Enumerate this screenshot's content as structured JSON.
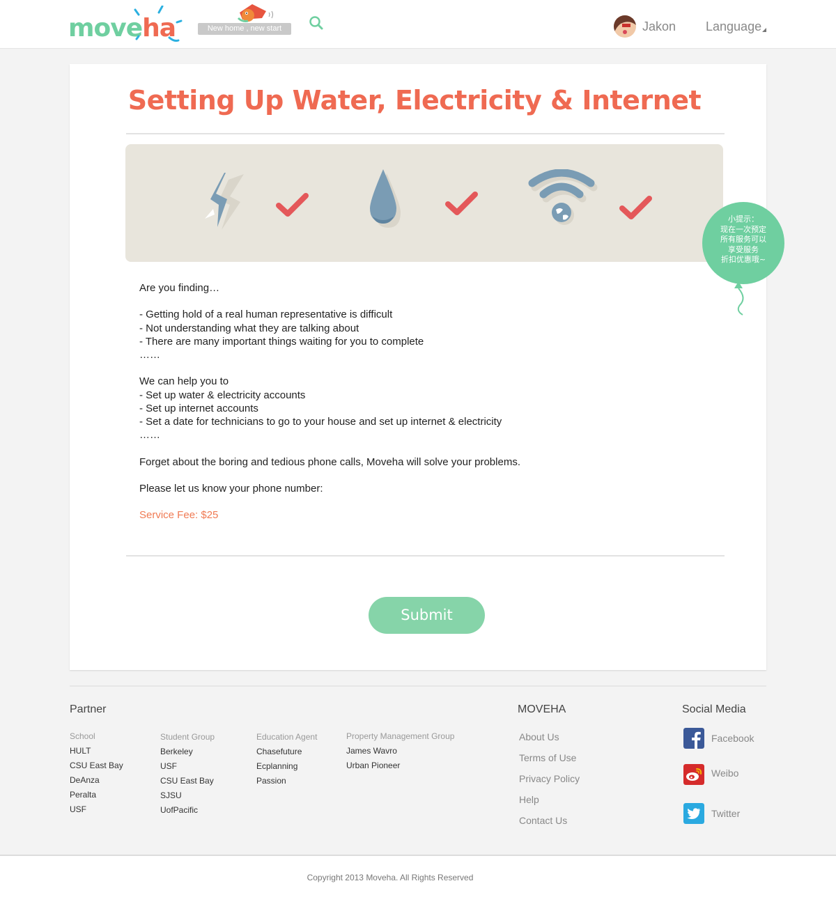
{
  "header": {
    "logo_part1": "move",
    "logo_part2": "ha",
    "tagline": "New home ,  new start",
    "username": "Jakon",
    "language": "Language"
  },
  "main": {
    "title": "Setting Up Water, Electricity & Internet",
    "intro": "Are you finding…",
    "problems": [
      "- Getting hold of a real human representative is difficult",
      "- Not understanding what they are talking about",
      "- There are many important things waiting for you to complete",
      "……"
    ],
    "help_heading": "We can help you to",
    "help_items": [
      "- Set up water & electricity accounts",
      "- Set up internet accounts",
      "- Set a date for technicians to go to your house and set up internet & electricity",
      "……"
    ],
    "closing": "Forget about the boring and tedious phone calls, Moveha will solve your problems.",
    "phone_prompt": "Please let us know your phone number:",
    "service_fee": "Service Fee: $25",
    "submit_label": "Submit"
  },
  "tip_balloon": {
    "lines": [
      "小提示：",
      "现在一次预定",
      "所有服务可以",
      "享受服务",
      "折扣优惠哦~"
    ]
  },
  "footer": {
    "partner_heading": "Partner",
    "columns": [
      {
        "category": "School",
        "items": [
          "HULT",
          "CSU East Bay",
          "DeAnza",
          "Peralta",
          "USF"
        ]
      },
      {
        "category": "Student Group",
        "items": [
          "Berkeley",
          "USF",
          "CSU East Bay",
          "SJSU",
          "UofPacific"
        ]
      },
      {
        "category": "Education Agent",
        "items": [
          "Chasefuture",
          "Ecplanning",
          "Passion"
        ]
      },
      {
        "category": "Property Management Group",
        "items": [
          "James Wavro",
          "Urban Pioneer"
        ]
      }
    ],
    "moveha_heading": "MOVEHA",
    "moveha_links": [
      "About Us",
      "Terms of Use",
      "Privacy Policy",
      "Help",
      "Contact Us"
    ],
    "social_heading": "Social Media",
    "social": [
      {
        "label": "Facebook",
        "icon": "facebook-icon",
        "color": "#3b5998"
      },
      {
        "label": "Weibo",
        "icon": "weibo-icon",
        "color": "#d52b2b"
      },
      {
        "label": "Twitter",
        "icon": "twitter-icon",
        "color": "#2aa9e0"
      }
    ],
    "copyright": "Copyright 2013 Moveha.  All Rights Reserved"
  },
  "colors": {
    "brand_green": "#6fcfa0",
    "brand_orange": "#ef6a52",
    "check_red": "#e4585a",
    "icon_blue": "#7a9cb4"
  }
}
